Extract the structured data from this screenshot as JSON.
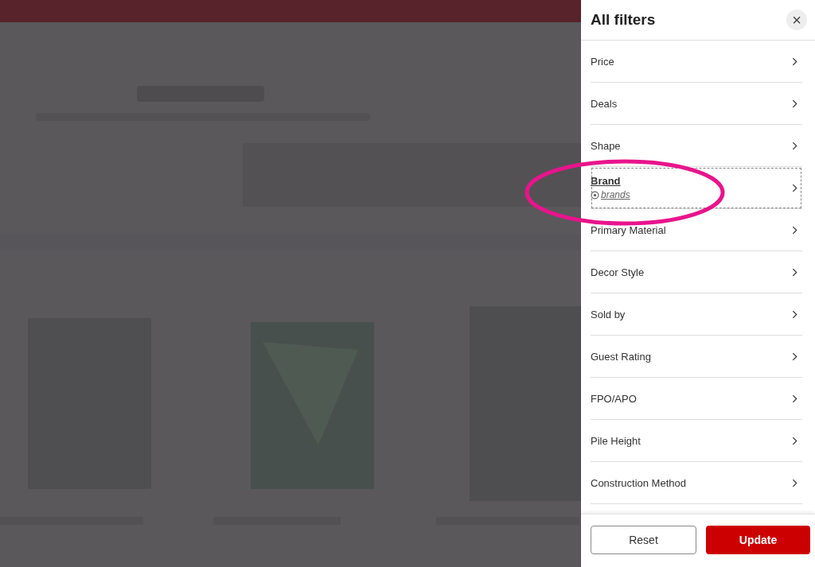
{
  "panel": {
    "title": "All filters",
    "close": "×"
  },
  "filters": [
    {
      "label": "Price",
      "focused": false
    },
    {
      "label": "Deals",
      "focused": false
    },
    {
      "label": "Shape",
      "focused": false
    },
    {
      "label": "Brand",
      "focused": true,
      "sub": "brands"
    },
    {
      "label": "Primary Material",
      "focused": false
    },
    {
      "label": "Decor Style",
      "focused": false
    },
    {
      "label": "Sold by",
      "focused": false
    },
    {
      "label": "Guest Rating",
      "focused": false
    },
    {
      "label": "FPO/APO",
      "focused": false
    },
    {
      "label": "Pile Height",
      "focused": false
    },
    {
      "label": "Construction Method",
      "focused": false
    }
  ],
  "buttons": [
    {
      "label": "Reset",
      "kind": "secondary"
    },
    {
      "label": "Update",
      "kind": "primary"
    }
  ]
}
